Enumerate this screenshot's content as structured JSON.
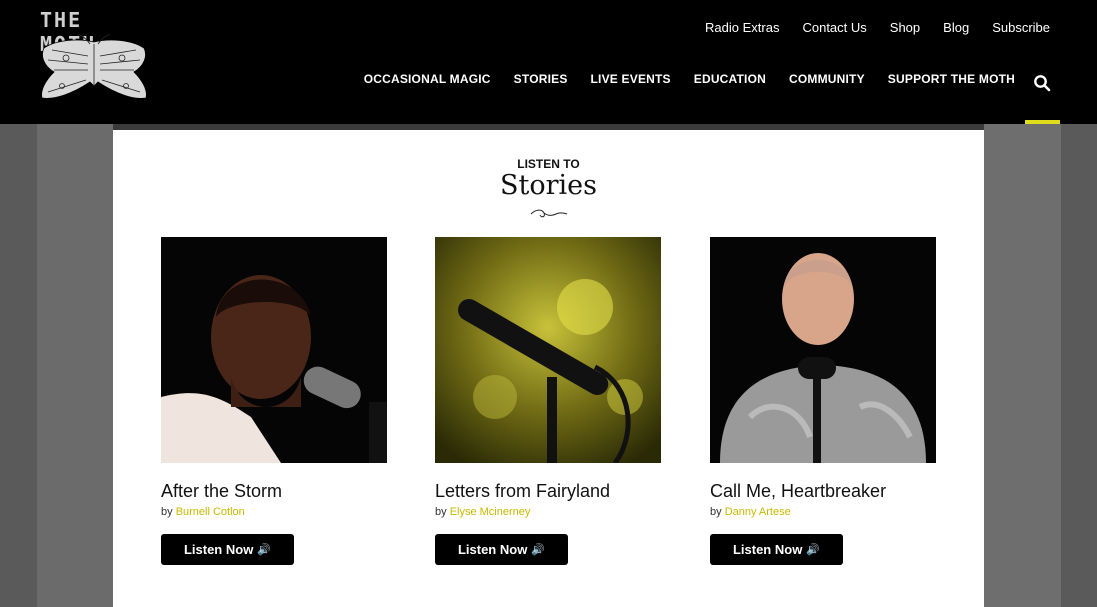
{
  "brand": {
    "name": "THE MOTH"
  },
  "utility_nav": [
    "Radio Extras",
    "Contact Us",
    "Shop",
    "Blog",
    "Subscribe"
  ],
  "main_nav": [
    "OCCASIONAL MAGIC",
    "STORIES",
    "LIVE EVENTS",
    "EDUCATION",
    "COMMUNITY",
    "SUPPORT THE MOTH"
  ],
  "section": {
    "eyebrow": "LISTEN TO",
    "title": "Stories"
  },
  "stories": [
    {
      "title": "After the Storm",
      "by": "by",
      "author": "Burnell Cotlon",
      "button": "Listen Now",
      "icon": "speaker-icon"
    },
    {
      "title": "Letters from Fairyland",
      "by": "by",
      "author": "Elyse Mcinerney",
      "button": "Listen Now",
      "icon": "speaker-icon"
    },
    {
      "title": "Call Me, Heartbreaker",
      "by": "by",
      "author": "Danny Artese",
      "button": "Listen Now",
      "icon": "speaker-icon"
    }
  ],
  "colors": {
    "accent": "#e1dc1b",
    "author": "#c9b800",
    "header_bg": "#000000"
  }
}
